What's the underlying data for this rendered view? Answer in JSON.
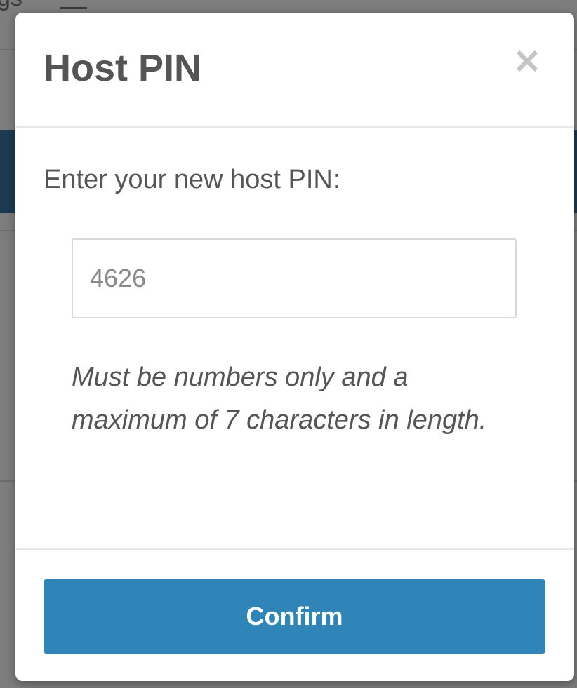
{
  "background_page": {
    "partial_text": "gs",
    "accent_color": "#1c3a52"
  },
  "modal": {
    "title": "Host PIN",
    "close_icon": "close-icon",
    "prompt": "Enter your new host PIN:",
    "pin_input": {
      "value": "4626",
      "placeholder": ""
    },
    "help_text": "Must be numbers only and a maximum of 7 characters in length.",
    "confirm_label": "Confirm",
    "confirm_color": "#2f85b8"
  }
}
